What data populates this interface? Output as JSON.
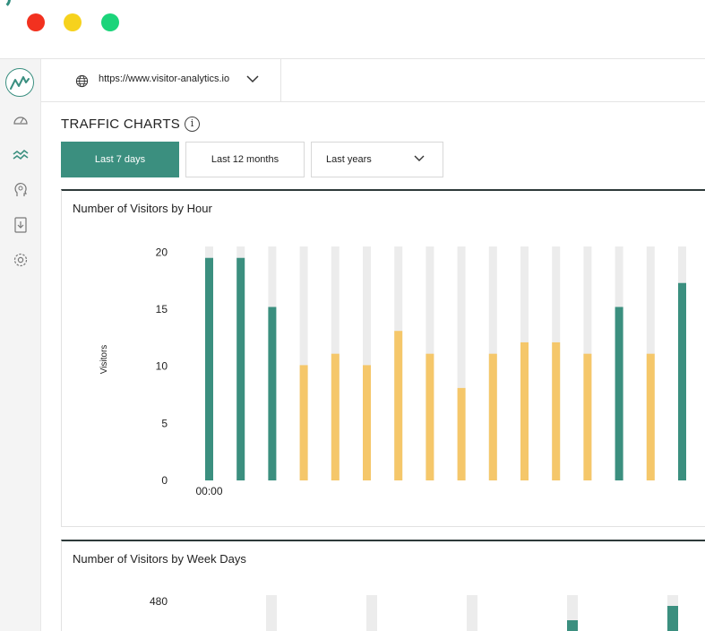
{
  "window": {
    "controls": [
      "close",
      "minimize",
      "maximize"
    ]
  },
  "sidebar": {
    "logo_icon": "line-chart-logo",
    "items": [
      {
        "icon": "gauge-icon",
        "active": false
      },
      {
        "icon": "chart-trend-icon",
        "active": true
      },
      {
        "icon": "head-profile-icon",
        "active": false
      },
      {
        "icon": "download-file-icon",
        "active": false
      },
      {
        "icon": "gear-icon",
        "active": false
      }
    ]
  },
  "urlbar": {
    "icon": "globe-icon",
    "url": "https://www.visitor-analytics.io"
  },
  "page": {
    "title": "TRAFFIC CHARTS",
    "info_icon": "i"
  },
  "tabs": [
    {
      "label": "Last 7 days",
      "active": true
    },
    {
      "label": "Last 12 months",
      "active": false
    },
    {
      "label": "Last years",
      "active": false,
      "dropdown": true
    }
  ],
  "colors": {
    "accent": "#3b8f7f",
    "highlight": "#f5c76a",
    "track": "#ececec",
    "text": "#222222"
  },
  "charts": [
    {
      "title": "Number of Visitors by Hour",
      "ylabel": "Visitors",
      "yticks": [
        "20",
        "15",
        "10",
        "5",
        "0"
      ],
      "first_x_label": "00:00"
    },
    {
      "title": "Number of Visitors by Week Days",
      "yticks": [
        "480"
      ]
    }
  ],
  "chart_data": [
    {
      "type": "bar",
      "title": "Number of Visitors by Hour",
      "ylabel": "Visitors",
      "ylim": [
        0,
        20.5
      ],
      "yticks": [
        0,
        5,
        10,
        15,
        20
      ],
      "x_labels": [
        "00:00"
      ],
      "values": [
        19.5,
        19.5,
        15.2,
        10.1,
        11.1,
        10.1,
        13.1,
        11.1,
        8.1,
        11.1,
        12.1,
        12.1,
        11.1,
        15.2,
        11.1,
        17.3
      ],
      "highlighted": [
        false,
        false,
        false,
        true,
        true,
        true,
        true,
        true,
        true,
        true,
        true,
        true,
        true,
        false,
        true,
        false
      ],
      "grid": false,
      "legend": "none"
    },
    {
      "type": "bar",
      "title": "Number of Visitors by Week Days",
      "yticks": [
        480
      ],
      "grid": false,
      "legend": "none"
    }
  ]
}
